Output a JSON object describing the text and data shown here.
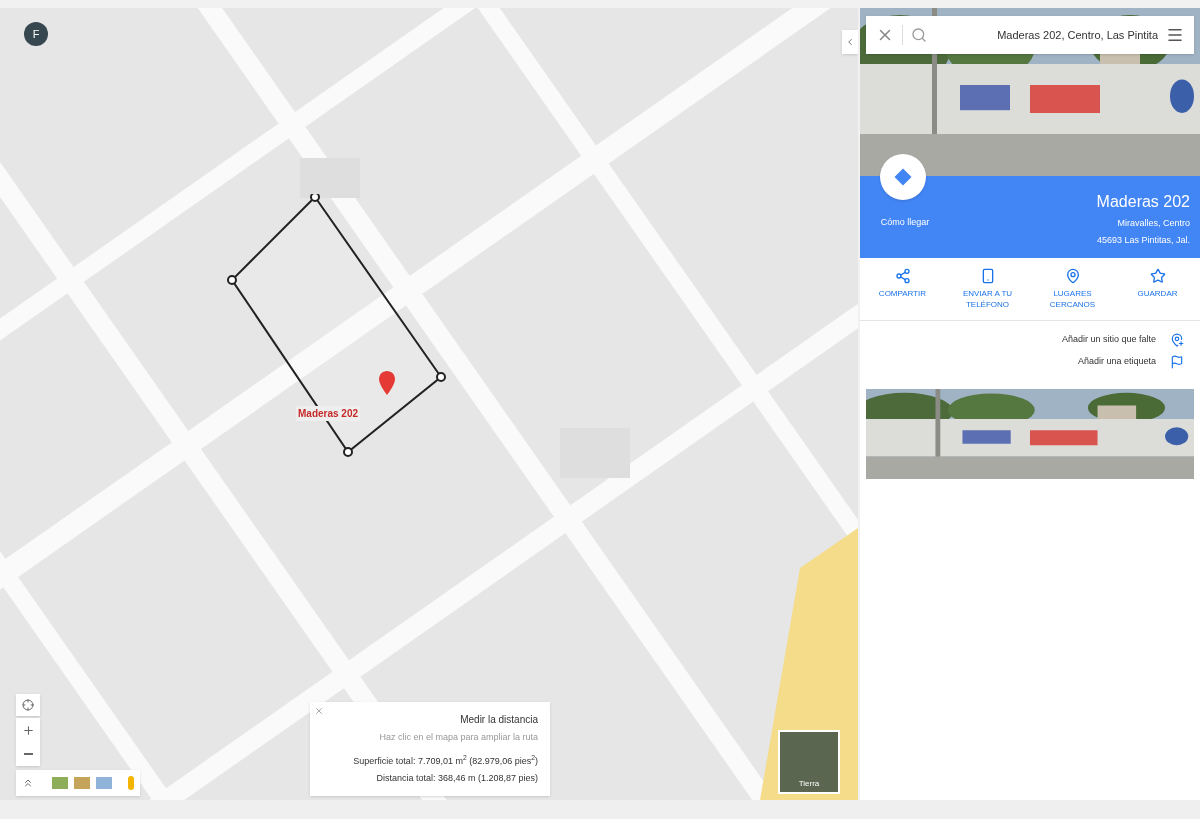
{
  "map": {
    "account_initial": "F",
    "marker_label": "Maderas 202",
    "layer_label": "Tierra"
  },
  "measure": {
    "title": "Medir la distancia",
    "hint": "Haz clic en el mapa para ampliar la ruta",
    "area": "Superficie total: 7.709,01 m$^{2}$ (82.979,06 pies$^{2}$)",
    "distance": "Distancia total: 368,46 m (1.208,87 pies)"
  },
  "search": {
    "value": "Maderas 202, Centro, Las Pintita"
  },
  "place": {
    "title": "Maderas 202",
    "line_1": "Miravalles, Centro",
    "line_2": "45693 Las Pintitas, Jal.",
    "directions": "Cómo llegar"
  },
  "actions": [
    {
      "kind": "share",
      "label": "COMPARTIR"
    },
    {
      "kind": "phone",
      "label": "ENVIAR A TU TELÉFONO"
    },
    {
      "kind": "nearby",
      "label": "LUGARES CERCANOS"
    },
    {
      "kind": "save",
      "label": "GUARDAR"
    }
  ],
  "links": [
    {
      "kind": "place",
      "label": "Añadir un sitio que falte"
    },
    {
      "kind": "label",
      "label": "Añadir una etiqueta"
    }
  ]
}
